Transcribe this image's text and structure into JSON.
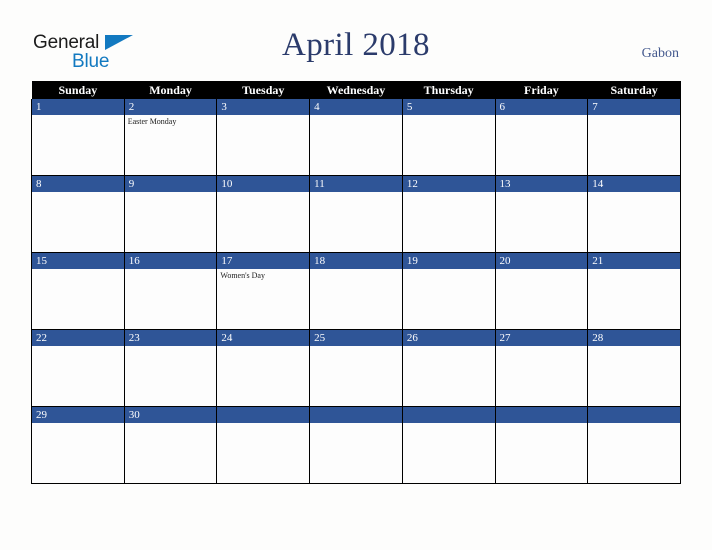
{
  "brand": {
    "name_part1": "General",
    "name_part2": "Blue",
    "triangle_color": "#1279c0",
    "text_color": "#1c1c1c"
  },
  "header": {
    "title": "April 2018",
    "country": "Gabon",
    "title_color": "#2b3b6b",
    "country_color": "#44598e"
  },
  "calendar": {
    "accent_color": "#2f5597",
    "header_bg": "#000000",
    "weekday_headers": [
      "Sunday",
      "Monday",
      "Tuesday",
      "Wednesday",
      "Thursday",
      "Friday",
      "Saturday"
    ],
    "weeks": [
      [
        {
          "date": "1",
          "events": []
        },
        {
          "date": "2",
          "events": [
            "Easter Monday"
          ]
        },
        {
          "date": "3",
          "events": []
        },
        {
          "date": "4",
          "events": []
        },
        {
          "date": "5",
          "events": []
        },
        {
          "date": "6",
          "events": []
        },
        {
          "date": "7",
          "events": []
        }
      ],
      [
        {
          "date": "8",
          "events": []
        },
        {
          "date": "9",
          "events": []
        },
        {
          "date": "10",
          "events": []
        },
        {
          "date": "11",
          "events": []
        },
        {
          "date": "12",
          "events": []
        },
        {
          "date": "13",
          "events": []
        },
        {
          "date": "14",
          "events": []
        }
      ],
      [
        {
          "date": "15",
          "events": []
        },
        {
          "date": "16",
          "events": []
        },
        {
          "date": "17",
          "events": [
            "Women's Day"
          ]
        },
        {
          "date": "18",
          "events": []
        },
        {
          "date": "19",
          "events": []
        },
        {
          "date": "20",
          "events": []
        },
        {
          "date": "21",
          "events": []
        }
      ],
      [
        {
          "date": "22",
          "events": []
        },
        {
          "date": "23",
          "events": []
        },
        {
          "date": "24",
          "events": []
        },
        {
          "date": "25",
          "events": []
        },
        {
          "date": "26",
          "events": []
        },
        {
          "date": "27",
          "events": []
        },
        {
          "date": "28",
          "events": []
        }
      ],
      [
        {
          "date": "29",
          "events": []
        },
        {
          "date": "30",
          "events": []
        },
        {
          "date": "",
          "events": []
        },
        {
          "date": "",
          "events": []
        },
        {
          "date": "",
          "events": []
        },
        {
          "date": "",
          "events": []
        },
        {
          "date": "",
          "events": []
        }
      ]
    ]
  }
}
